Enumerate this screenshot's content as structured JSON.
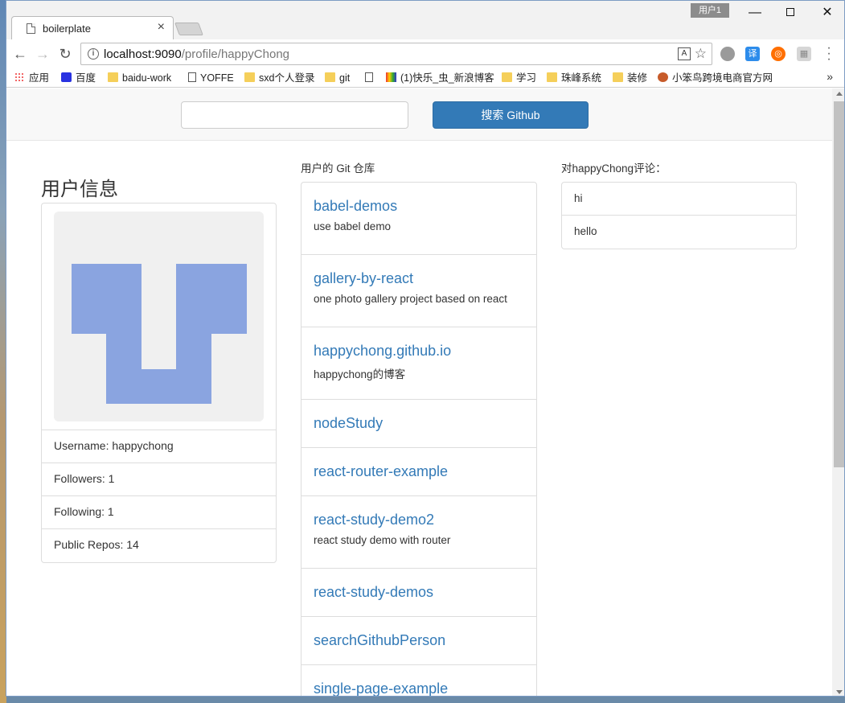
{
  "browser": {
    "tab_title": "boilerplate",
    "user_badge": "用户1",
    "url_host": "localhost:9090",
    "url_path": "/profile/happyChong",
    "bookmarks": [
      "应用",
      "百度",
      "baidu-work",
      "YOFFE",
      "sxd个人登录",
      "git",
      "",
      "(1)快乐_虫_新浪博客",
      "学习",
      "珠峰系统",
      "装修",
      "小笨鸟跨境电商官方网"
    ],
    "ext_translate_label": "译"
  },
  "search": {
    "placeholder": "",
    "button_label": "搜索 Github"
  },
  "user": {
    "heading": "用户信息",
    "rows": [
      "Username: happychong",
      "Followers: 1",
      "Following: 1",
      "Public Repos: 14"
    ],
    "avatar_color": "#8aa4e0"
  },
  "repos": {
    "heading": "用户的 Git 仓库",
    "items": [
      {
        "name": "babel-demos",
        "desc": "use babel demo"
      },
      {
        "name": "gallery-by-react",
        "desc": "one photo gallery project based on react"
      },
      {
        "name": "happychong.github.io",
        "desc": "happychong的博客"
      },
      {
        "name": "nodeStudy",
        "desc": ""
      },
      {
        "name": "react-router-example",
        "desc": ""
      },
      {
        "name": "react-study-demo2",
        "desc": "react study demo with router"
      },
      {
        "name": "react-study-demos",
        "desc": ""
      },
      {
        "name": "searchGithubPerson",
        "desc": ""
      },
      {
        "name": "single-page-example",
        "desc": ""
      }
    ]
  },
  "comments": {
    "heading": "对happyChong评论：",
    "items": [
      "hi",
      "hello"
    ]
  },
  "colors": {
    "link": "#337ab7",
    "primary_button": "#337ab7"
  }
}
